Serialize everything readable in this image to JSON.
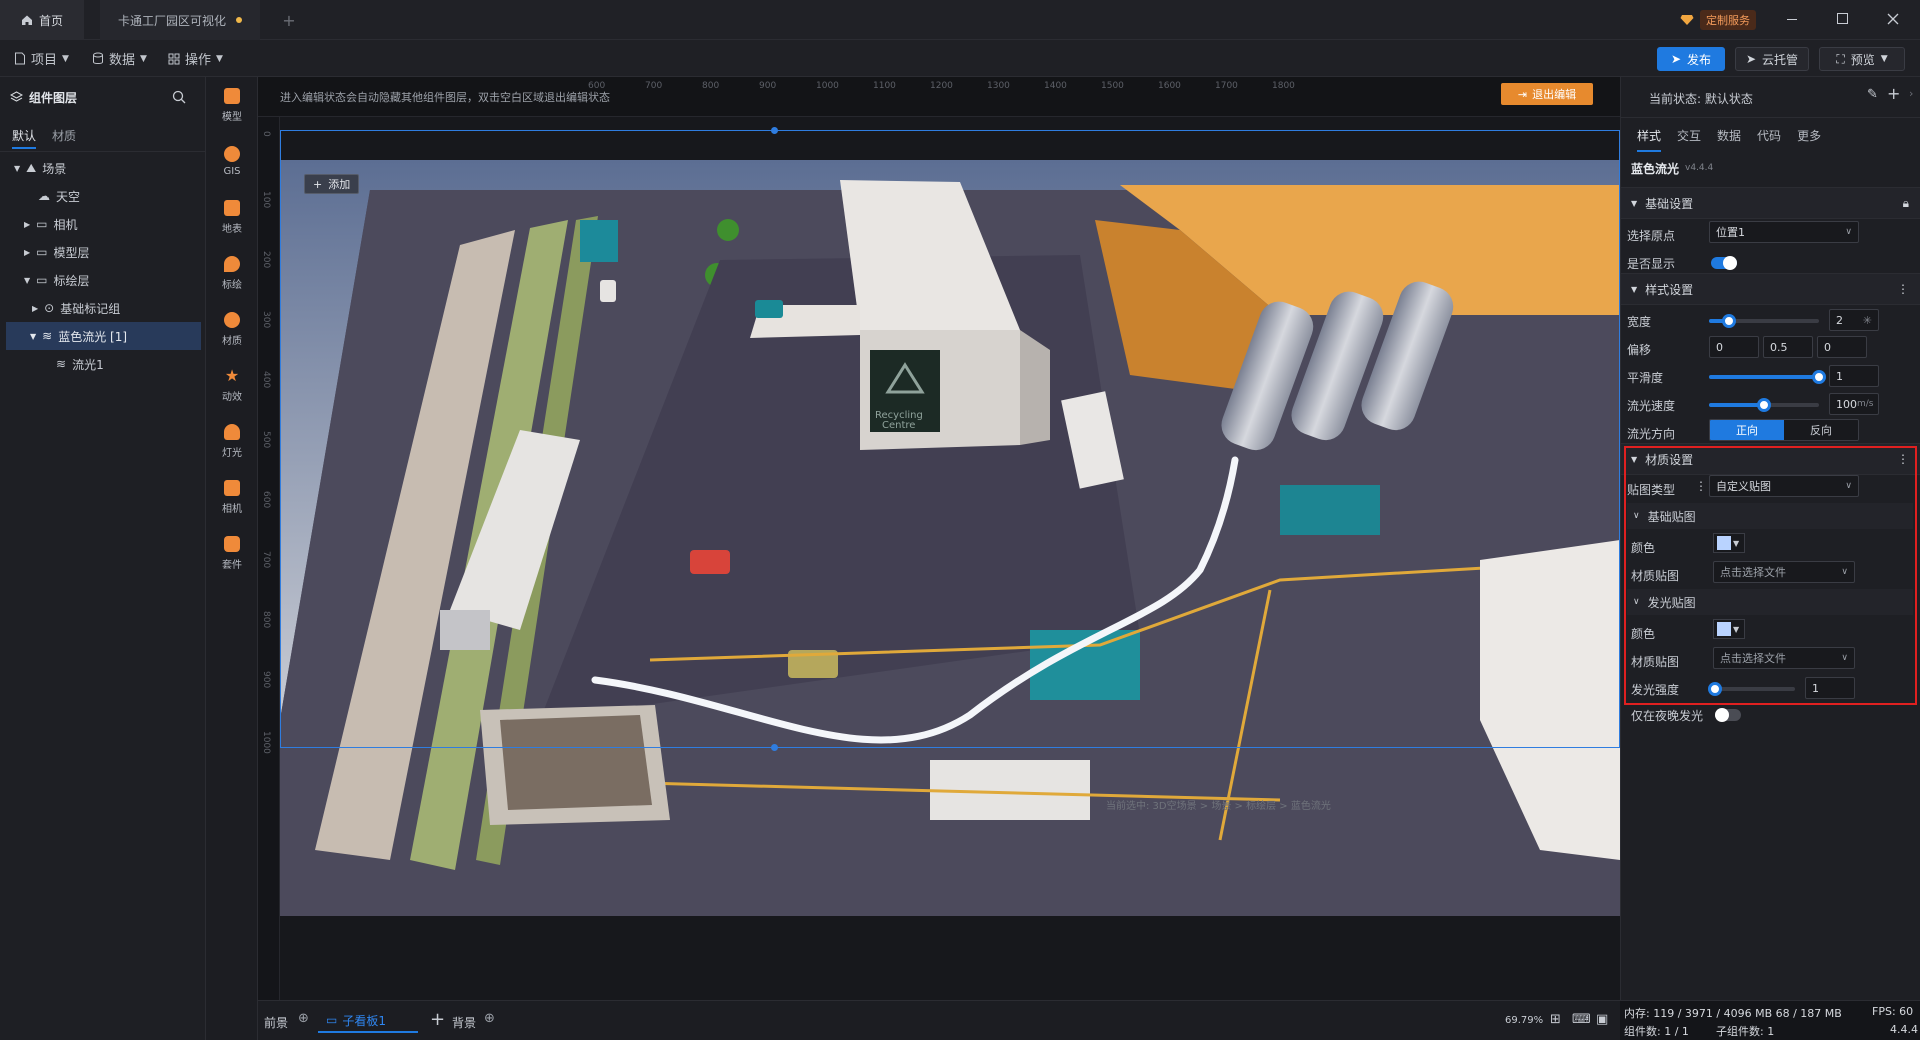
{
  "titlebar": {
    "home_tab": "首页",
    "project_tab": "卡通工厂园区可视化",
    "add_tab": "+",
    "custom_service": "定制服务"
  },
  "menubar": {
    "project": "项目",
    "data": "数据",
    "operate": "操作",
    "publish": "发布",
    "cloud_host": "云托管",
    "preview": "预览"
  },
  "left_panel": {
    "title": "组件图层",
    "tabs": [
      "默认",
      "材质"
    ],
    "tree": [
      {
        "label": "场景",
        "depth": 0
      },
      {
        "label": "天空",
        "depth": 1
      },
      {
        "label": "相机",
        "depth": 1
      },
      {
        "label": "模型层",
        "depth": 1
      },
      {
        "label": "标绘层",
        "depth": 1
      },
      {
        "label": "基础标记组",
        "depth": 2
      },
      {
        "label": "蓝色流光 [1]",
        "depth": 2
      },
      {
        "label": "流光1",
        "depth": 3
      }
    ]
  },
  "tools": [
    "模型",
    "GIS",
    "地表",
    "标绘",
    "材质",
    "动效",
    "灯光",
    "相机",
    "套件"
  ],
  "canvas": {
    "hint": "进入编辑状态会自动隐藏其他组件图层，双击空白区域退出编辑状态",
    "exit_edit": "退出编辑",
    "add_button": "添加",
    "sign_line1": "Recycling",
    "sign_line2": "Centre",
    "breadcrumb": "当前选中: 3D空场景 > 场景 > 标绘层 > 蓝色流光",
    "ruler_top": [
      "600",
      "700",
      "800",
      "900",
      "1000",
      "1100",
      "1200",
      "1300",
      "1400",
      "1500",
      "1600",
      "1700",
      "1800"
    ],
    "ruler_left": [
      "0",
      "100",
      "200",
      "300",
      "400",
      "500",
      "600",
      "700",
      "800",
      "900",
      "1000"
    ]
  },
  "bottombar": {
    "front": "前景",
    "sub_panel": "子看板1",
    "add": "+",
    "background": "背景",
    "zoom": "69.79%"
  },
  "right_panel": {
    "state_label": "当前状态: 默认状态",
    "tabs": [
      "样式",
      "交互",
      "数据",
      "代码",
      "更多"
    ],
    "component_name": "蓝色流光",
    "version": "v4.4.4",
    "basic_section": "基础设置",
    "origin_label": "选择原点",
    "origin_value": "位置1",
    "visible_label": "是否显示",
    "style_section": "样式设置",
    "width_label": "宽度",
    "width_value": "2",
    "width_level": 0.18,
    "offset_label": "偏移",
    "offset_values": [
      "0",
      "0.5",
      "0"
    ],
    "smooth_label": "平滑度",
    "smooth_value": "1",
    "smooth_level": 1.0,
    "speed_label": "流光速度",
    "speed_value": "100",
    "speed_unit": "m/s",
    "speed_level": 0.5,
    "direction_label": "流光方向",
    "direction_forward": "正向",
    "direction_reverse": "反向",
    "material_section": "材质设置",
    "texture_type_label": "贴图类型",
    "texture_type_value": "自定义贴图",
    "base_texture_section": "基础贴图",
    "color_label": "颜色",
    "material_texture_label": "材质贴图",
    "choose_file": "点击选择文件",
    "glow_section": "发光贴图",
    "glow_color_label": "颜色",
    "glow_texture_label": "材质贴图",
    "glow_choose_file": "点击选择文件",
    "glow_strength_label": "发光强度",
    "glow_strength_value": "1",
    "glow_strength_level": 0.0,
    "night_only_label": "仅在夜晚发光",
    "swatch_color": "#b9d3ff",
    "accent_color": "#1f7ae0",
    "highlight_color": "#e02020"
  },
  "status": {
    "memory": "内存: 119 / 3971 / 4096 MB  68 / 187 MB",
    "fps": "FPS: 60",
    "components": "组件数: 1 / 1",
    "sub_components": "子组件数: 1",
    "version": "4.4.4"
  }
}
